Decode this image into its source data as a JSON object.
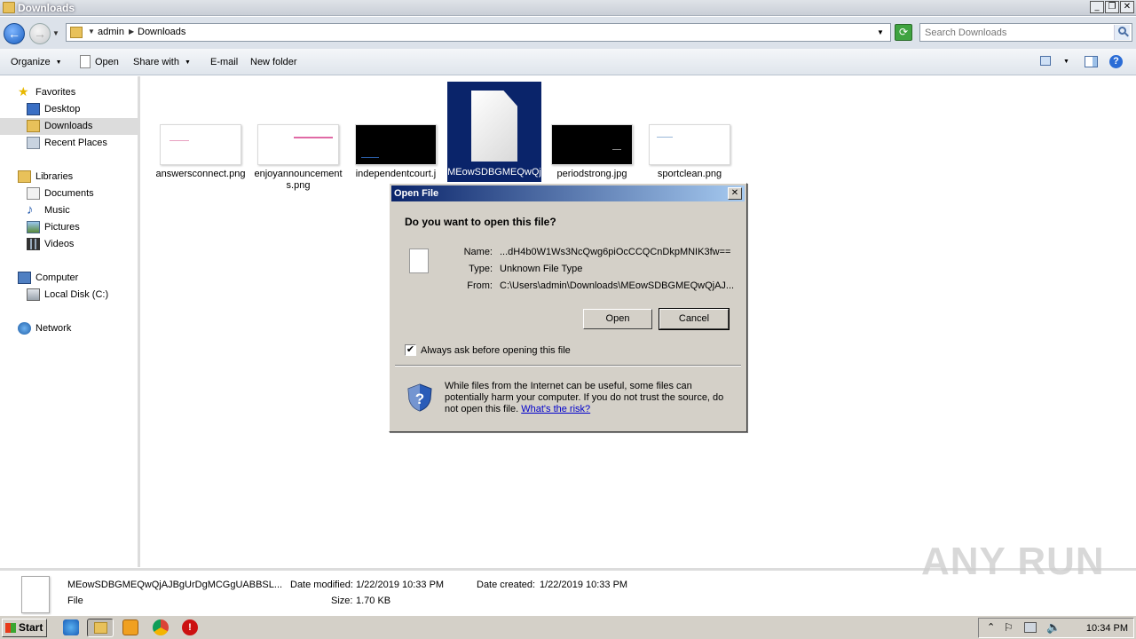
{
  "window": {
    "title": "Downloads"
  },
  "address": {
    "crumbs": [
      "admin",
      "Downloads"
    ],
    "search_placeholder": "Search Downloads"
  },
  "commandbar": {
    "organize": "Organize",
    "open": "Open",
    "share_with": "Share with",
    "email": "E-mail",
    "new_folder": "New folder"
  },
  "navpane": {
    "favorites": "Favorites",
    "desktop": "Desktop",
    "downloads": "Downloads",
    "recent_places": "Recent Places",
    "libraries": "Libraries",
    "documents": "Documents",
    "music": "Music",
    "pictures": "Pictures",
    "videos": "Videos",
    "computer": "Computer",
    "local_disk": "Local Disk (C:)",
    "network": "Network"
  },
  "files": [
    {
      "name": "answersconnect.png"
    },
    {
      "name": "enjoyannouncements.png"
    },
    {
      "name": "independentcourt.j"
    },
    {
      "name": "MEowSDBGMEQwQj"
    },
    {
      "name": "periodstrong.jpg"
    },
    {
      "name": "sportclean.png"
    }
  ],
  "dialog": {
    "title": "Open File",
    "question": "Do you want to open this file?",
    "name_label": "Name:",
    "name_value": "...dH4b0W1Ws3NcQwg6piOcCCQCnDkpMNIK3fw==",
    "type_label": "Type:",
    "type_value": "Unknown File Type",
    "from_label": "From:",
    "from_value": "C:\\Users\\admin\\Downloads\\MEowSDBGMEQwQjAJ...",
    "open_button": "Open",
    "cancel_button": "Cancel",
    "checkbox_label": "Always ask before opening this file",
    "checkbox_checked": true,
    "checkbox_mark": "✔",
    "warning_text": "While files from the Internet can be useful, some files can potentially harm your computer. If you do not trust the source, do not open this file.",
    "risk_link": "What's the risk?"
  },
  "details": {
    "filename": "MEowSDBGMEQwQjAJBgUrDgMCGgUABBSL...",
    "filetype": "File",
    "date_modified_label": "Date modified:",
    "date_modified": "1/22/2019 10:33 PM",
    "size_label": "Size:",
    "size": "1.70 KB",
    "date_created_label": "Date created:",
    "date_created": "1/22/2019 10:33 PM"
  },
  "taskbar": {
    "start": "Start",
    "clock": "10:34 PM"
  },
  "watermark": "ANY RUN"
}
